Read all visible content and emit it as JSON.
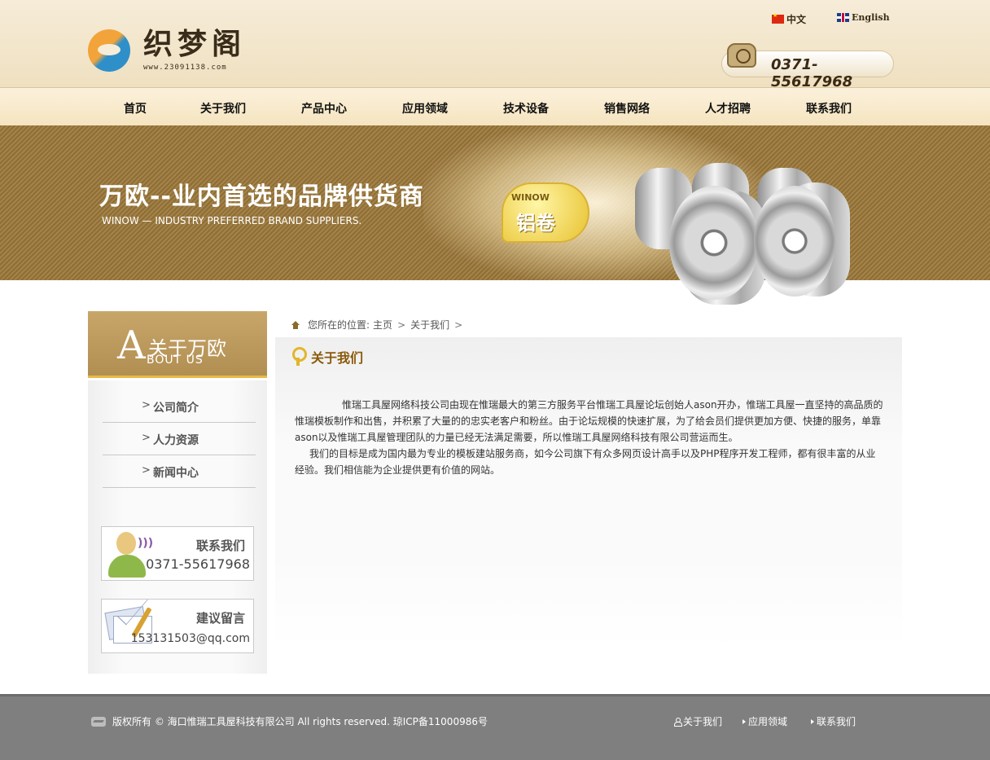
{
  "header": {
    "logo_text": "织梦阁",
    "logo_url": "www.23091138.com",
    "lang_cn": "中文",
    "lang_en": "English",
    "phone": "0371-55617968"
  },
  "nav": {
    "items": [
      {
        "label": "首页"
      },
      {
        "label": "关于我们"
      },
      {
        "label": "产品中心"
      },
      {
        "label": "应用领域"
      },
      {
        "label": "技术设备"
      },
      {
        "label": "销售网络"
      },
      {
        "label": "人才招聘"
      },
      {
        "label": "联系我们"
      }
    ]
  },
  "banner": {
    "title": "万欧--业内首选的品牌供货商",
    "subtitle": "WINOW — INDUSTRY PREFERRED BRAND SUPPLIERS.",
    "badge_brand": "WINOW",
    "badge_text": "铝卷"
  },
  "sidebar": {
    "head_letter": "A",
    "head_title": "关于万欧",
    "head_sub": "BOUT US",
    "items": [
      {
        "label": "公司简介"
      },
      {
        "label": "人力资源"
      },
      {
        "label": "新闻中心"
      }
    ],
    "contact_title": "联系我们",
    "contact_phone": "0371-55617968",
    "message_title": "建议留言",
    "message_email": "153131503@qq.com"
  },
  "breadcrumb": {
    "prefix": "您所在的位置:",
    "home": "主页",
    "current": "关于我们"
  },
  "main": {
    "title": "关于我们",
    "para1": "惟瑞工具屋网络科技公司由现在惟瑞最大的第三方服务平台惟瑞工具屋论坛创始人ason开办，惟瑞工具屋一直坚持的高品质的惟瑞模板制作和出售，并积累了大量的的忠实老客户和粉丝。由于论坛规模的快速扩展，为了给会员们提供更加方便、快捷的服务，单靠ason以及惟瑞工具屋管理团队的力量已经无法满足需要，所以惟瑞工具屋网络科技有限公司营运而生。",
    "para2": "我们的目标是成为国内最为专业的模板建站服务商，如今公司旗下有众多网页设计高手以及PHP程序开发工程师，都有很丰富的从业经验。我们相信能为企业提供更有价值的网站。"
  },
  "footer": {
    "copyright": "版权所有 © 海口惟瑞工具屋科技有限公司 All rights reserved. 琼ICP备11000986号",
    "links": [
      {
        "label": "关于我们"
      },
      {
        "label": "应用领域"
      },
      {
        "label": "联系我们"
      }
    ]
  }
}
